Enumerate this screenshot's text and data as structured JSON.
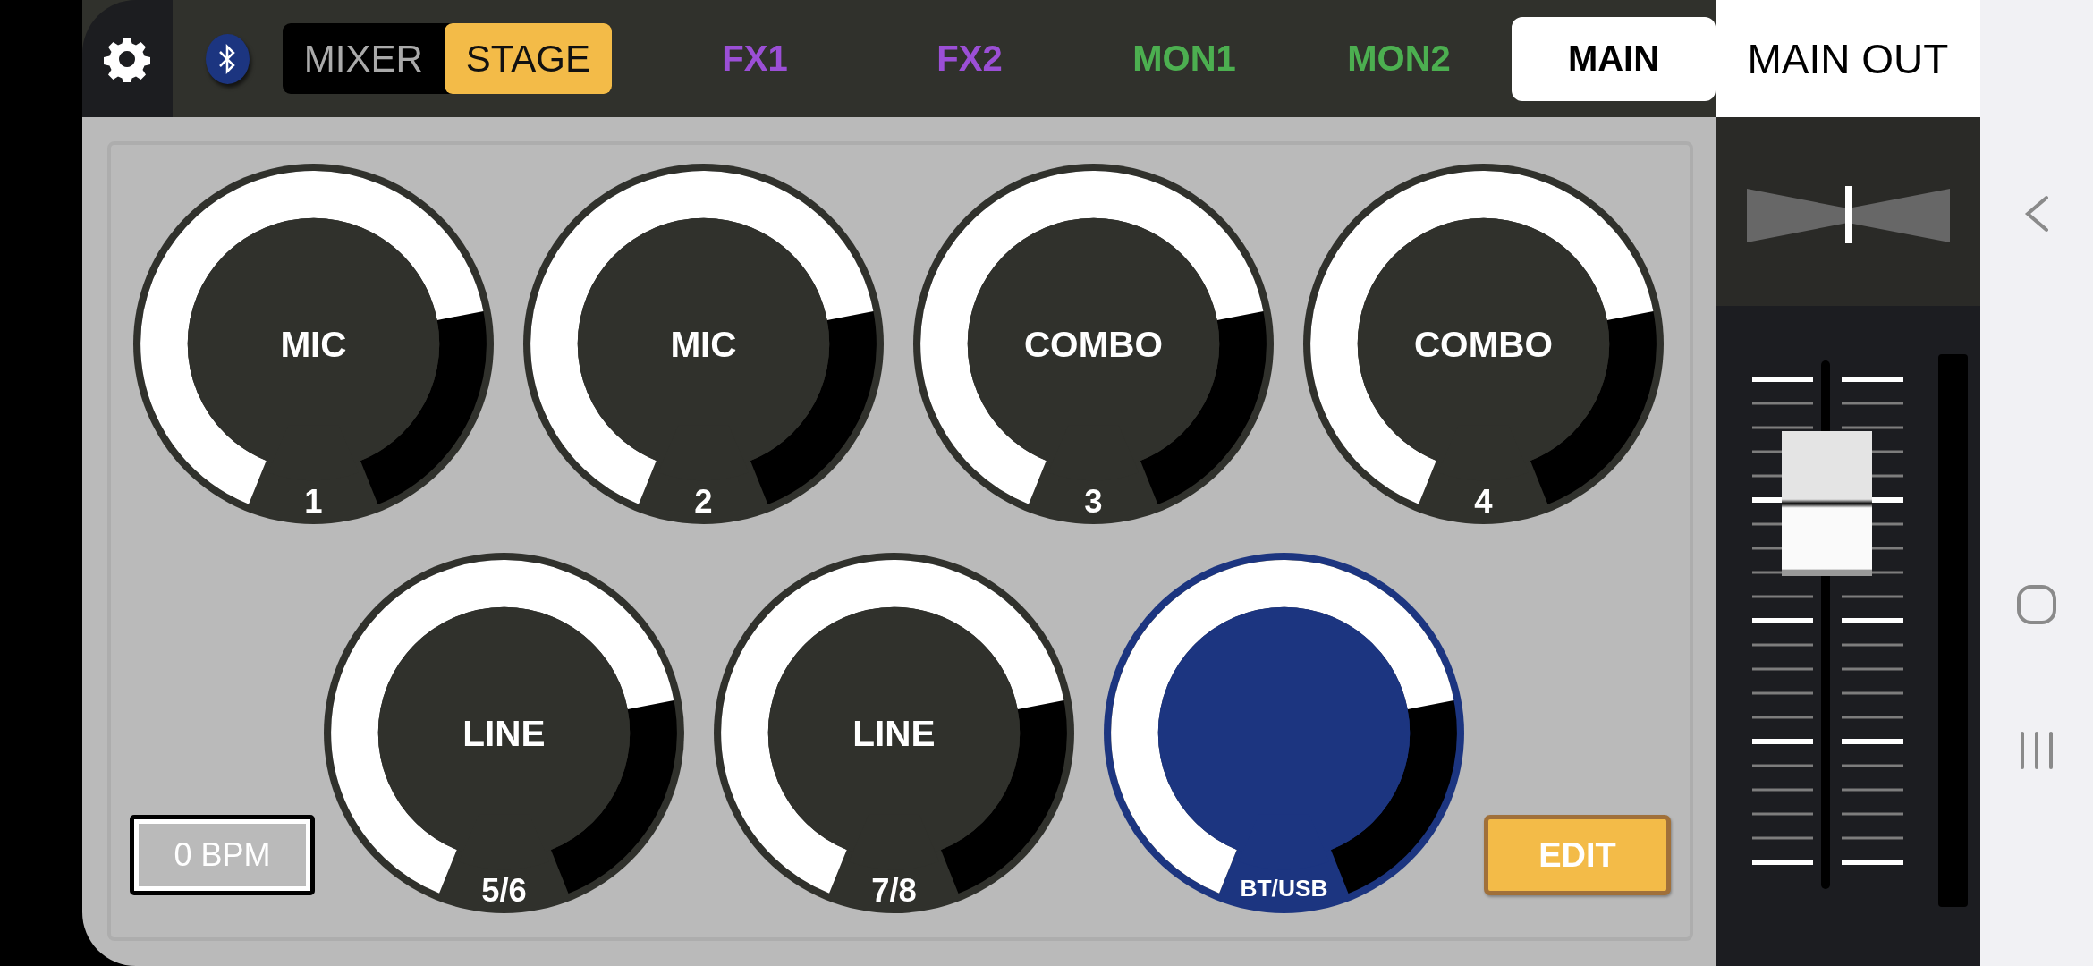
{
  "mode_switch": [
    {
      "label": "MIXER",
      "selected": false
    },
    {
      "label": "STAGE",
      "selected": true
    }
  ],
  "tabs": [
    {
      "label": "FX1",
      "color": "#9b4fd6",
      "selected": false
    },
    {
      "label": "FX2",
      "color": "#9b4fd6",
      "selected": false
    },
    {
      "label": "MON1",
      "color": "#4caf50",
      "selected": false
    },
    {
      "label": "MON2",
      "color": "#4caf50",
      "selected": false
    },
    {
      "label": "MAIN",
      "color": "#000000",
      "selected": true
    }
  ],
  "knob_rows": [
    [
      {
        "label": "MIC",
        "number": "1",
        "level": 0.75,
        "color": "#30312c"
      },
      {
        "label": "MIC",
        "number": "2",
        "level": 0.75,
        "color": "#30312c"
      },
      {
        "label": "COMBO",
        "number": "3",
        "level": 0.75,
        "color": "#30312c"
      },
      {
        "label": "COMBO",
        "number": "4",
        "level": 0.75,
        "color": "#30312c"
      }
    ],
    [
      {
        "label": "LINE",
        "number": "5/6",
        "level": 0.75,
        "color": "#30312c"
      },
      {
        "label": "LINE",
        "number": "7/8",
        "level": 0.75,
        "color": "#30312c"
      },
      {
        "number": "BT/USB",
        "level": 0.75,
        "color": "#1c3580"
      }
    ]
  ],
  "bpm": "0 BPM",
  "edit_button": "EDIT",
  "output": {
    "title": "MAIN OUT",
    "pan": {
      "level": 0.5
    },
    "fader": {
      "level": 0.73
    }
  }
}
